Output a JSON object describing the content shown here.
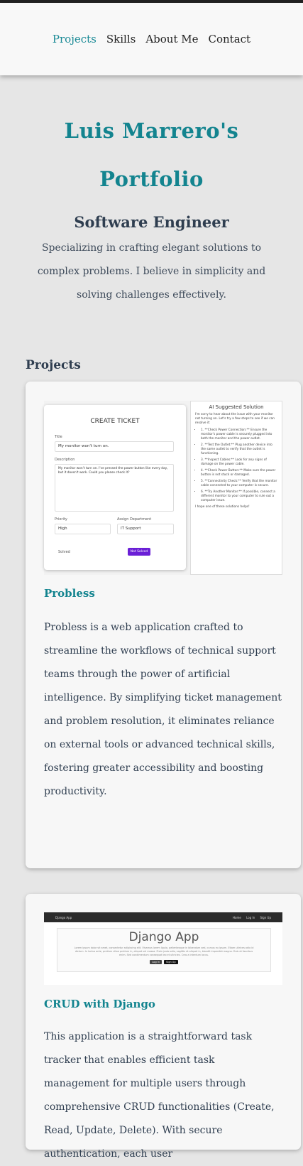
{
  "nav": {
    "items": [
      {
        "label": "Projects",
        "active": true
      },
      {
        "label": "Skills",
        "active": false
      },
      {
        "label": "About Me",
        "active": false
      },
      {
        "label": "Contact",
        "active": false
      }
    ]
  },
  "hero": {
    "title_line1": "Luis Marrero's",
    "title_line2": "Portfolio",
    "role": "Software Engineer",
    "tagline": "Specializing in crafting elegant solutions to complex problems. I believe in simplicity and solving challenges effectively."
  },
  "projects": {
    "section_title": "Projects",
    "items": [
      {
        "name": "Probless",
        "description": "Probless is a web application crafted to streamline the workflows of technical support teams through the power of artificial intelligence. By simplifying ticket management and problem resolution, it eliminates reliance on external tools or advanced technical skills, fostering greater accessibility and boosting productivity.",
        "screenshot": {
          "ticket_title": "CREATE TICKET",
          "title_label": "Title",
          "title_value": "My monitor won't turn on.",
          "desc_label": "Description",
          "desc_value": "My monitor won't turn on. I've pressed the power button like every day, but it doesn't work. Could you please check it?",
          "priority_label": "Priority",
          "priority_value": "High",
          "dept_label": "Assign Department",
          "dept_value": "IT Support",
          "solved_label": "Solved",
          "status_button": "Not Solved",
          "ai_title": "AI Suggested Solution",
          "ai_intro": "I'm sorry to hear about the issue with your monitor not turning on. Let's try a few steps to see if we can resolve it:",
          "ai_steps": [
            "1. **Check Power Connection:** Ensure the monitor's power cable is securely plugged into both the monitor and the power outlet.",
            "2. **Test the Outlet:** Plug another device into the same outlet to verify that the outlet is functioning.",
            "3. **Inspect Cables:** Look for any signs of damage on the power cable.",
            "4. **Check Power Button:** Make sure the power button is not stuck or damaged.",
            "5. **Connectivity Check:** Verify that the monitor cable connected to your computer is secure.",
            "6. **Try Another Monitor:** If possible, connect a different monitor to your computer to rule out a computer issue."
          ],
          "ai_outro": "I hope one of these solutions helps!"
        }
      },
      {
        "name": "CRUD with Django",
        "description": "This application is a straightforward task tracker that enables efficient task management for multiple users through comprehensive CRUD functionalities (Create, Read, Update, Delete). With secure authentication, each user",
        "screenshot": {
          "brand": "Django App",
          "links": [
            "Home",
            "Log In",
            "Sign Up"
          ],
          "heading": "Django App",
          "body": "Lorem ipsum dolor sit amet, consectetur adipiscing elit. Vivamus lorem ligula, pellentesque in bibendum sed, cursus eu ipsum. Etiam ultrices odio id dictum. In luctus ante, pretium vitae pretium in, aliquet vel massa. Proin justo odio, sagittis et aliquet in, blandit imperdiet magna. Duis et faucibus enim. Sed condimentum consequat leo et ultricies. Cras a interdum lacus.",
          "btn_login": "Log In",
          "btn_signup": "Sign Up"
        }
      }
    ]
  }
}
